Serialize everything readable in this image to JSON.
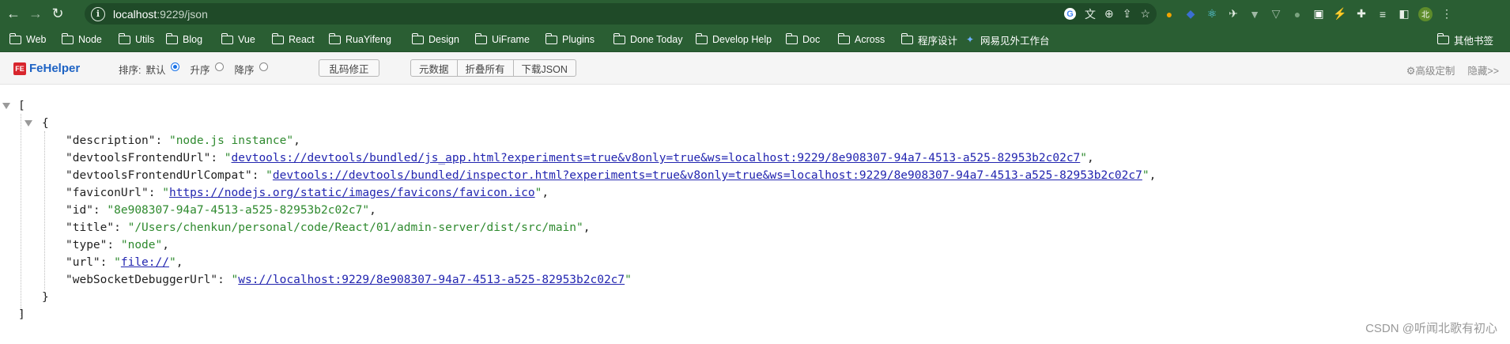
{
  "browser": {
    "url_host": "localhost",
    "url_path": ":9229/json",
    "omnibox_icons": [
      "google-icon",
      "translate-icon",
      "zoom-icon",
      "share-icon",
      "bookmark-star-icon"
    ],
    "extensions": [
      {
        "name": "ext-1-icon",
        "color": "#f2a300",
        "glyph": "●"
      },
      {
        "name": "ext-2-icon",
        "color": "#3b6fd1",
        "glyph": "◆"
      },
      {
        "name": "react-devtools-icon",
        "color": "#61dafb",
        "glyph": "⚛"
      },
      {
        "name": "ext-4-icon",
        "color": "#e8f0e8",
        "glyph": "✈"
      },
      {
        "name": "vue-devtools-icon",
        "color": "#9fb8a4",
        "glyph": "▼"
      },
      {
        "name": "vue-devtools-2-icon",
        "color": "#9fb8a4",
        "glyph": "▽"
      },
      {
        "name": "ext-7-icon",
        "color": "#7aa37f",
        "glyph": "●"
      },
      {
        "name": "ext-8-icon",
        "color": "#ffffff",
        "glyph": "▣"
      },
      {
        "name": "ext-9-icon",
        "color": "#3b8bff",
        "glyph": "⚡"
      },
      {
        "name": "extensions-puzzle-icon",
        "color": "#e8f0e8",
        "glyph": "✚"
      },
      {
        "name": "reading-list-icon",
        "color": "#e8f0e8",
        "glyph": "≡"
      },
      {
        "name": "side-panel-icon",
        "color": "#e8f0e8",
        "glyph": "◧"
      },
      {
        "name": "profile-avatar",
        "color": "#5e8c2b",
        "glyph": "北"
      },
      {
        "name": "menu-kebab-icon",
        "color": "#e8f0e8",
        "glyph": "⋮"
      }
    ],
    "bookmarks": [
      {
        "label": "Web"
      },
      {
        "label": "Node"
      },
      {
        "label": "Utils"
      },
      {
        "label": "Blog"
      },
      {
        "label": "Vue"
      },
      {
        "label": "React"
      },
      {
        "label": "RuaYifeng"
      },
      {
        "label": "Design"
      },
      {
        "label": "UiFrame"
      },
      {
        "label": "Plugins"
      },
      {
        "label": "Done Today"
      },
      {
        "label": "Develop Help"
      },
      {
        "label": "Doc"
      },
      {
        "label": "Across"
      },
      {
        "label": "程序设计"
      }
    ],
    "bookmark_link": "网易见外工作台",
    "other_bookmarks": "其他书签"
  },
  "fehelper": {
    "logo_badge": "FE",
    "name": "FeHelper",
    "sort_label": "排序:",
    "sort_options": [
      {
        "label": "默认",
        "checked": true
      },
      {
        "label": "升序",
        "checked": false
      },
      {
        "label": "降序",
        "checked": false
      }
    ],
    "fix_encoding": "乱码修正",
    "buttons": [
      "元数据",
      "折叠所有",
      "下载JSON"
    ],
    "advanced": "高级定制",
    "hide": "隐藏>>"
  },
  "json": {
    "open_array": "[",
    "open_obj": "{",
    "close_obj": "}",
    "close_array": "]",
    "entries": [
      {
        "key": "description",
        "value": "node.js instance",
        "link": false,
        "comma": true
      },
      {
        "key": "devtoolsFrontendUrl",
        "value": "devtools://devtools/bundled/js_app.html?experiments=true&v8only=true&ws=localhost:9229/8e908307-94a7-4513-a525-82953b2c02c7",
        "link": true,
        "comma": true
      },
      {
        "key": "devtoolsFrontendUrlCompat",
        "value": "devtools://devtools/bundled/inspector.html?experiments=true&v8only=true&ws=localhost:9229/8e908307-94a7-4513-a525-82953b2c02c7",
        "link": true,
        "comma": true
      },
      {
        "key": "faviconUrl",
        "value": "https://nodejs.org/static/images/favicons/favicon.ico",
        "link": true,
        "comma": true
      },
      {
        "key": "id",
        "value": "8e908307-94a7-4513-a525-82953b2c02c7",
        "link": false,
        "comma": true
      },
      {
        "key": "title",
        "value": "/Users/chenkun/personal/code/React/01/admin-server/dist/src/main",
        "link": false,
        "comma": true
      },
      {
        "key": "type",
        "value": "node",
        "link": false,
        "comma": true
      },
      {
        "key": "url",
        "value": "file://",
        "link": true,
        "comma": true
      },
      {
        "key": "webSocketDebuggerUrl",
        "value": "ws://localhost:9229/8e908307-94a7-4513-a525-82953b2c02c7",
        "link": true,
        "comma": false
      }
    ]
  },
  "watermark": "CSDN @听闻北歌有初心",
  "colors": {
    "chrome_green": "#2a5e33",
    "string_green": "#2f8a2f",
    "link_blue": "#2225b0"
  }
}
